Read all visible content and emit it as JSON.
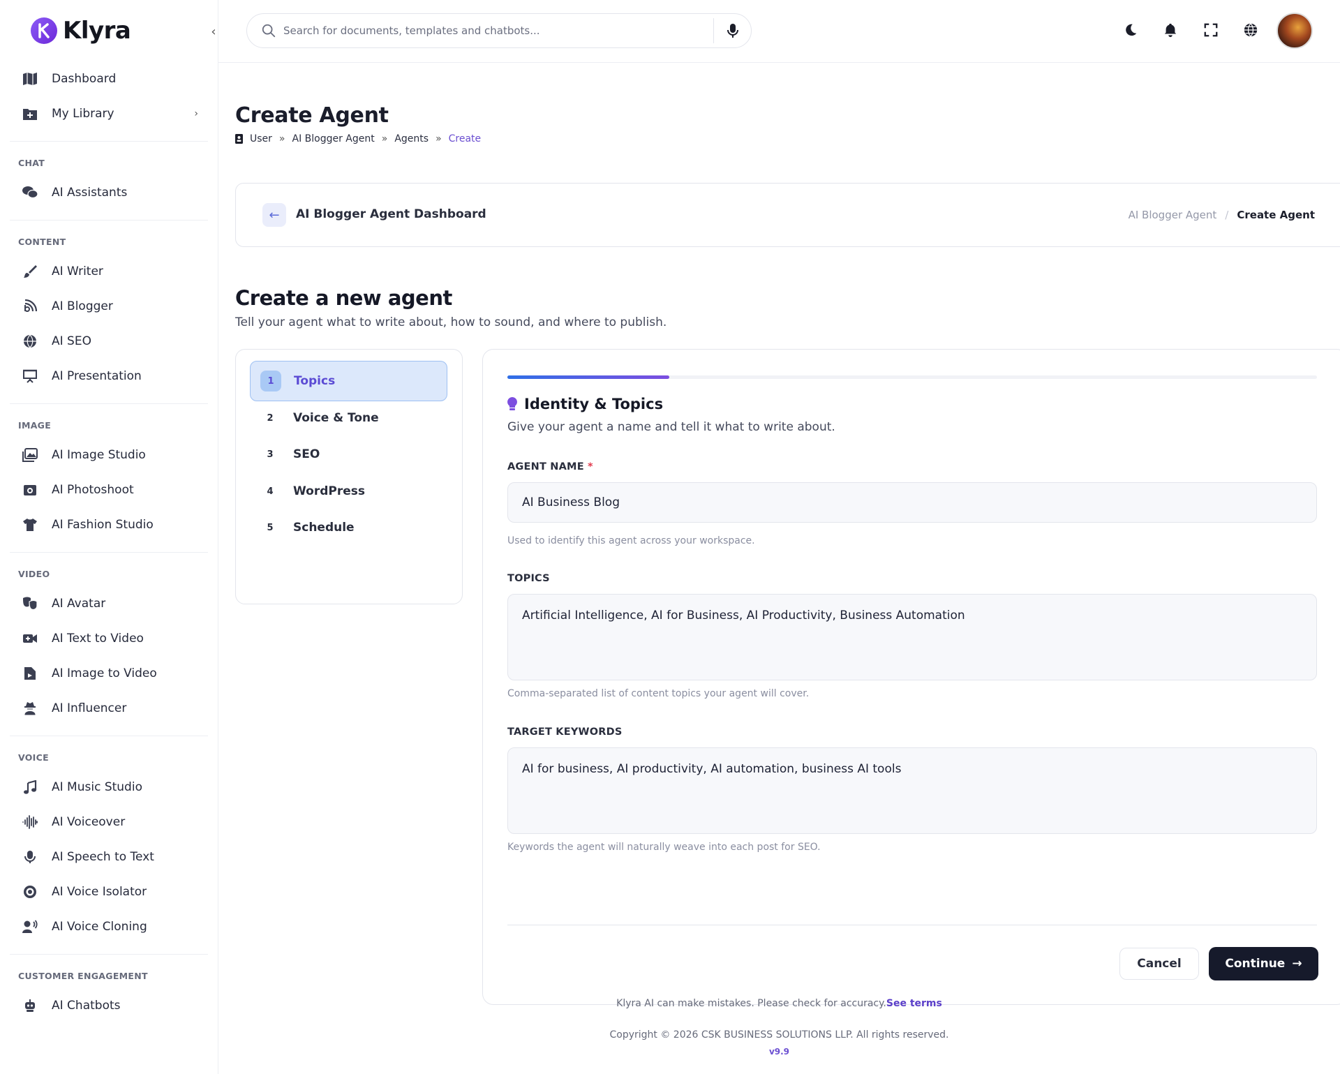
{
  "app": {
    "name": "Klyra"
  },
  "sidebar": {
    "top_items": [
      {
        "label": "Dashboard",
        "icon": "map-icon"
      },
      {
        "label": "My Library",
        "icon": "folder-plus-icon"
      }
    ],
    "sections": [
      {
        "heading": "CHAT",
        "items": [
          {
            "label": "AI Assistants",
            "icon": "chat-bubbles-icon"
          }
        ]
      },
      {
        "heading": "CONTENT",
        "items": [
          {
            "label": "AI Writer",
            "icon": "brush-icon"
          },
          {
            "label": "AI Blogger",
            "icon": "blog-icon"
          },
          {
            "label": "AI SEO",
            "icon": "globe-icon"
          },
          {
            "label": "AI Presentation",
            "icon": "presentation-icon"
          }
        ]
      },
      {
        "heading": "IMAGE",
        "items": [
          {
            "label": "AI Image Studio",
            "icon": "images-icon"
          },
          {
            "label": "AI Photoshoot",
            "icon": "camera-icon"
          },
          {
            "label": "AI Fashion Studio",
            "icon": "shirt-icon"
          }
        ]
      },
      {
        "heading": "VIDEO",
        "items": [
          {
            "label": "AI Avatar",
            "icon": "masks-icon"
          },
          {
            "label": "AI Text to Video",
            "icon": "video-plus-icon"
          },
          {
            "label": "AI Image to Video",
            "icon": "file-video-icon"
          },
          {
            "label": "AI Influencer",
            "icon": "user-secret-icon"
          }
        ]
      },
      {
        "heading": "VOICE",
        "items": [
          {
            "label": "AI Music Studio",
            "icon": "music-icon"
          },
          {
            "label": "AI Voiceover",
            "icon": "waveform-icon"
          },
          {
            "label": "AI Speech to Text",
            "icon": "microphone-icon"
          },
          {
            "label": "AI Voice Isolator",
            "icon": "target-icon"
          },
          {
            "label": "AI Voice Cloning",
            "icon": "user-voice-icon"
          }
        ]
      },
      {
        "heading": "CUSTOMER ENGAGEMENT",
        "items": [
          {
            "label": "AI Chatbots",
            "icon": "robot-icon"
          }
        ]
      }
    ]
  },
  "topbar": {
    "search_placeholder": "Search for documents, templates and chatbots..."
  },
  "page": {
    "title": "Create Agent",
    "breadcrumb": [
      "User",
      "AI Blogger Agent",
      "Agents",
      "Create"
    ]
  },
  "dash_card": {
    "title": "AI Blogger Agent Dashboard",
    "crumb_parent": "AI Blogger Agent",
    "crumb_sep": "/",
    "crumb_current": "Create Agent"
  },
  "intro": {
    "heading": "Create a new agent",
    "subtitle": "Tell your agent what to write about, how to sound, and where to publish."
  },
  "steps": [
    {
      "num": "1",
      "label": "Topics",
      "active": true
    },
    {
      "num": "2",
      "label": "Voice & Tone",
      "active": false
    },
    {
      "num": "3",
      "label": "SEO",
      "active": false
    },
    {
      "num": "4",
      "label": "WordPress",
      "active": false
    },
    {
      "num": "5",
      "label": "Schedule",
      "active": false
    }
  ],
  "form": {
    "progress": 0.2,
    "section_title": "Identity & Topics",
    "section_subtitle": "Give your agent a name and tell it what to write about.",
    "agent_name_label": "AGENT NAME",
    "required_mark": "*",
    "agent_name_value": "AI Business Blog",
    "agent_name_help": "Used to identify this agent across your workspace.",
    "topics_label": "TOPICS",
    "topics_value": "Artificial Intelligence, AI for Business, AI Productivity, Business Automation",
    "topics_help": "Comma-separated list of content topics your agent will cover.",
    "keywords_label": "TARGET KEYWORDS",
    "keywords_value": "AI for business, AI productivity, AI automation, business AI tools",
    "keywords_help": "Keywords the agent will naturally weave into each post for SEO.",
    "cancel_label": "Cancel",
    "continue_label": "Continue"
  },
  "footer": {
    "disclaimer": "Klyra AI can make mistakes. Please check for accuracy.",
    "terms_link": "See terms",
    "copyright": "Copyright © 2026 CSK BUSINESS SOLUTIONS LLP. All rights reserved.",
    "version": "v9.9"
  },
  "colors": {
    "accent": "#5b4bd4",
    "dark_button": "#161a2b",
    "required": "#e23b4e"
  }
}
